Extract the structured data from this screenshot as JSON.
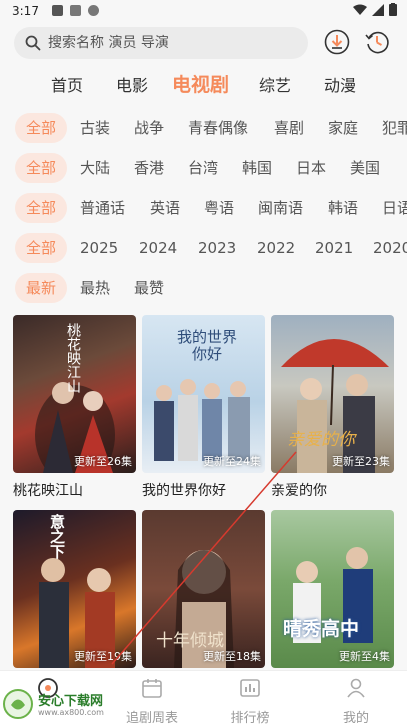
{
  "status": {
    "time": "3:17"
  },
  "search": {
    "placeholder": "搜索名称 演员 导演"
  },
  "main_tabs": [
    {
      "label": "首页"
    },
    {
      "label": "电影"
    },
    {
      "label": "电视剧",
      "active": true
    },
    {
      "label": "综艺"
    },
    {
      "label": "动漫"
    }
  ],
  "filters": {
    "genre": [
      "全部",
      "古装",
      "战争",
      "青春偶像",
      "喜剧",
      "家庭",
      "犯罪"
    ],
    "region": [
      "全部",
      "大陆",
      "香港",
      "台湾",
      "韩国",
      "日本",
      "美国"
    ],
    "language": [
      "全部",
      "普通话",
      "英语",
      "粤语",
      "闽南语",
      "韩语",
      "日语"
    ],
    "year": [
      "全部",
      "2025",
      "2024",
      "2023",
      "2022",
      "2021",
      "2020"
    ],
    "sort": [
      "最新",
      "最热",
      "最赞"
    ]
  },
  "cards": [
    {
      "title": "桃花映江山",
      "badge": "更新至26集",
      "poster_text": "桃花映江山"
    },
    {
      "title": "我的世界你好",
      "badge": "更新至24集",
      "poster_text": "我的世界你好"
    },
    {
      "title": "亲爱的你",
      "badge": "更新至23集",
      "poster_text": "亲爱的你"
    },
    {
      "title": "",
      "badge": "更新至19集",
      "poster_text": "意之下"
    },
    {
      "title": "",
      "badge": "更新至18集",
      "poster_text": "十年倾城"
    },
    {
      "title": "",
      "badge": "更新至4集",
      "poster_text": "晴秀高中"
    }
  ],
  "bottom_nav": [
    {
      "label": "",
      "icon": "home-icon"
    },
    {
      "label": "追剧周表",
      "icon": "calendar-icon"
    },
    {
      "label": "排行榜",
      "icon": "chart-icon"
    },
    {
      "label": "我的",
      "icon": "profile-icon"
    }
  ],
  "watermark": {
    "text": "安心下载网",
    "url": "www.ax800.com"
  },
  "colors": {
    "accent": "#f58a5b",
    "chip_bg": "#fbe7df"
  }
}
